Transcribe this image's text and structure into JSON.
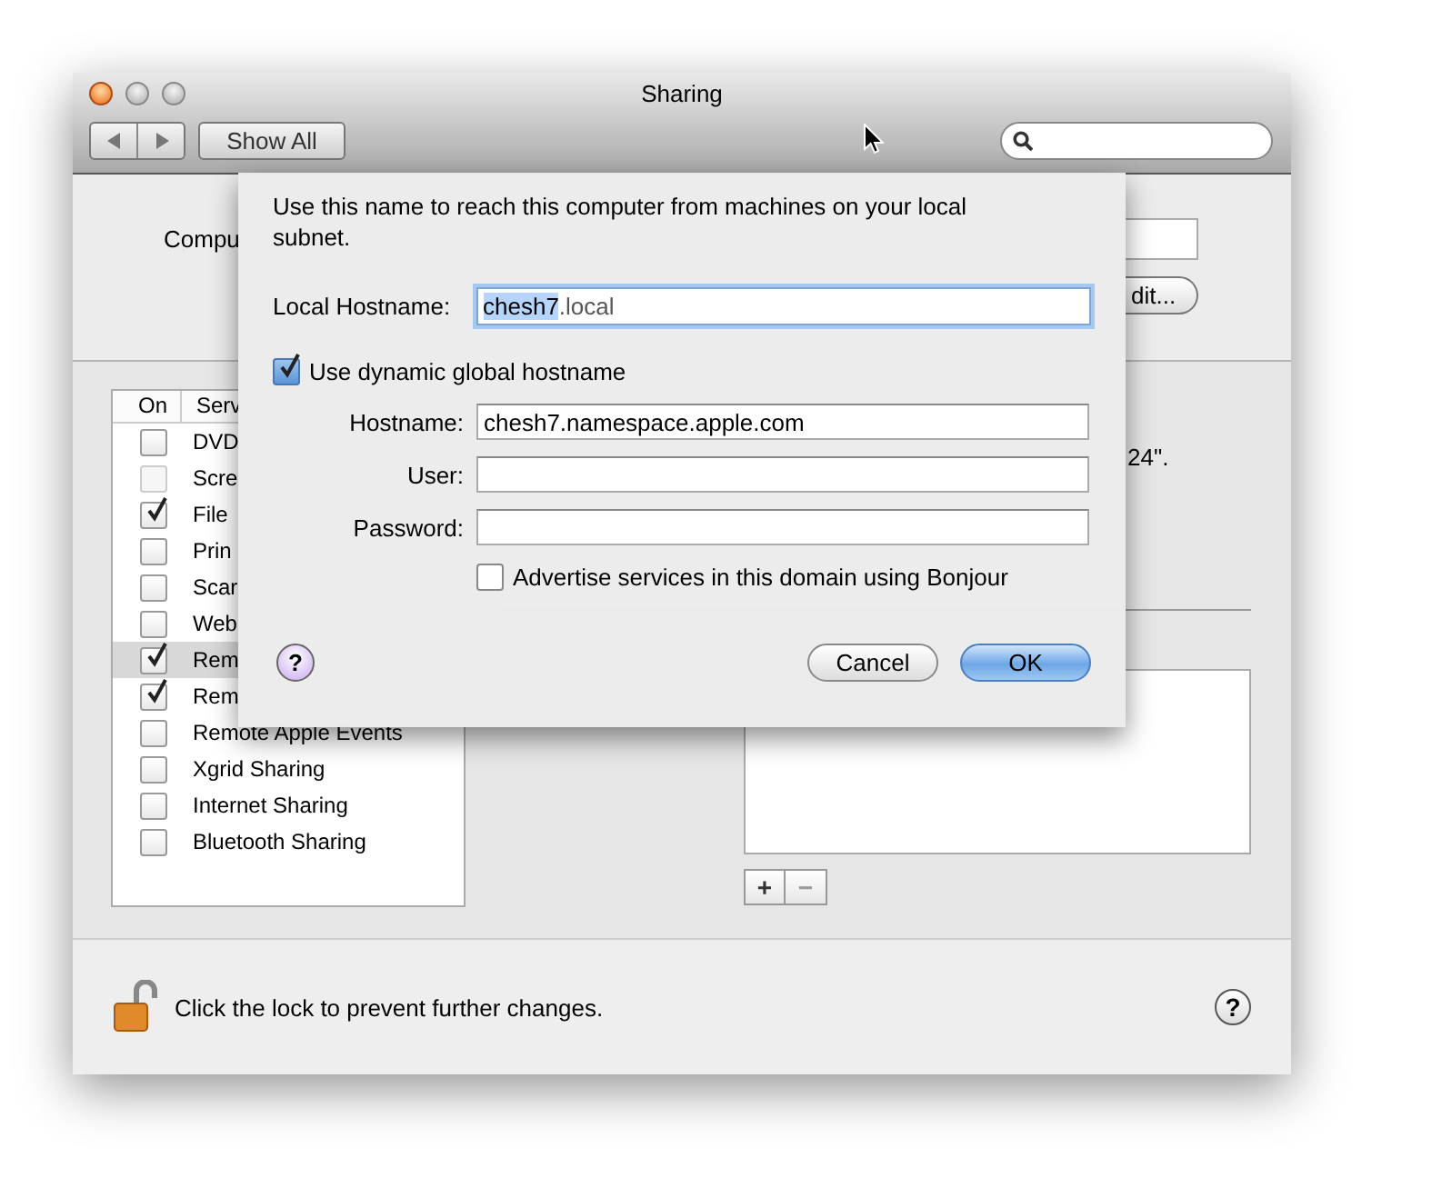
{
  "window": {
    "title": "Sharing",
    "show_all": "Show All"
  },
  "computer_name": {
    "label": "Compu",
    "edit_button": "dit..."
  },
  "services": {
    "columns": [
      "On",
      "Serv"
    ],
    "items": [
      {
        "label": "DVD",
        "checked": false,
        "disabled": false,
        "selected": false
      },
      {
        "label": "Scre",
        "checked": false,
        "disabled": true,
        "selected": false
      },
      {
        "label": "File",
        "checked": true,
        "disabled": false,
        "selected": false
      },
      {
        "label": "Prin",
        "checked": false,
        "disabled": false,
        "selected": false
      },
      {
        "label": "Scar",
        "checked": false,
        "disabled": false,
        "selected": false
      },
      {
        "label": "Web",
        "checked": false,
        "disabled": false,
        "selected": false
      },
      {
        "label": "Rem",
        "checked": true,
        "disabled": false,
        "selected": true
      },
      {
        "label": "Rem",
        "checked": true,
        "disabled": false,
        "selected": false
      },
      {
        "label": "Remote Apple Events",
        "checked": false,
        "disabled": false,
        "selected": false
      },
      {
        "label": "Xgrid Sharing",
        "checked": false,
        "disabled": false,
        "selected": false
      },
      {
        "label": "Internet Sharing",
        "checked": false,
        "disabled": false,
        "selected": false
      },
      {
        "label": "Bluetooth Sharing",
        "checked": false,
        "disabled": false,
        "selected": false
      }
    ]
  },
  "detail": {
    "fragment": "24\".",
    "add_button": "+",
    "remove_button": "−"
  },
  "footer": {
    "lock_text": "Click the lock to prevent further changes.",
    "help": "?"
  },
  "sheet": {
    "description": "Use this name to reach this computer from machines on your local subnet.",
    "local_hostname": {
      "label": "Local Hostname:",
      "value_parts": [
        {
          "text": "chesh7",
          "selected": true
        },
        {
          "text": ".local",
          "selected": false
        }
      ]
    },
    "dynamic_hostname": {
      "label": "Use dynamic global hostname",
      "checked": true
    },
    "fields": [
      {
        "label": "Hostname:",
        "value": "chesh7.namespace.apple.com"
      },
      {
        "label": "User:"
      },
      {
        "label": "Password:"
      }
    ],
    "bonjour": {
      "label": "Advertise services in this domain using Bonjour",
      "checked": false
    },
    "help": "?",
    "buttons": [
      {
        "label": "Cancel",
        "default": false
      },
      {
        "label": "OK",
        "default": true
      }
    ]
  }
}
